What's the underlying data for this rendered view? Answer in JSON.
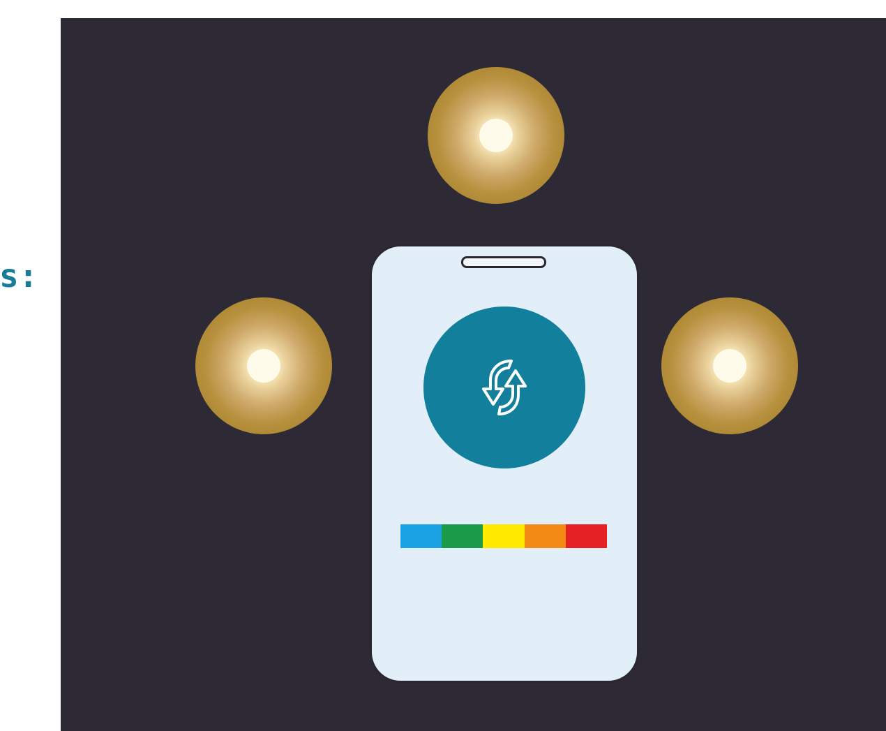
{
  "left_text": {
    "line1": "s:",
    "line2": ""
  },
  "lamps": [
    {
      "name": "top",
      "color": "#a9842d",
      "glow": "#fffbeb"
    },
    {
      "name": "left",
      "color": "#a9842d",
      "glow": "#fffbeb"
    },
    {
      "name": "right",
      "color": "#a9842d",
      "glow": "#fffbeb"
    }
  ],
  "phone": {
    "screen_color": "#e2eff9",
    "sync_icon": "sync-arrows-icon",
    "sync_circle_color": "#12809d",
    "color_bar": [
      "#1ba3e6",
      "#1b9a47",
      "#ffea00",
      "#f38a14",
      "#e52125"
    ]
  },
  "background": {
    "panel_color": "#2d2a35"
  }
}
